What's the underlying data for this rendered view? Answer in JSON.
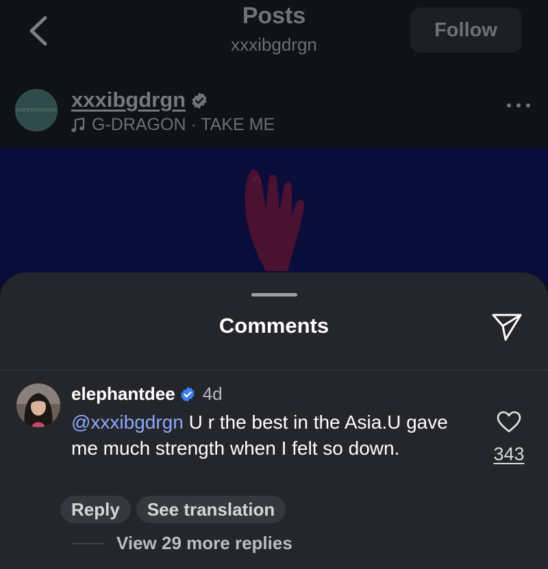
{
  "header": {
    "title": "Posts",
    "subtitle": "xxxibgdrgn",
    "follow_label": "Follow"
  },
  "post": {
    "username": "xxxibgdrgn",
    "verified": true,
    "music": "G-DRAGON · TAKE ME",
    "avatar_text": "Peaceminusone"
  },
  "comments_sheet": {
    "title": "Comments",
    "comment": {
      "username": "elephantdee",
      "verified": true,
      "time": "4d",
      "mention": "@xxxibgdrgn",
      "text": " U r the best in the Asia.U gave me much strength when I felt so down.",
      "like_count": "343",
      "reply_label": "Reply",
      "translate_label": "See translation",
      "view_replies": "View 29 more replies"
    }
  },
  "colors": {
    "sheet_bg": "#24262b",
    "mention": "#8ea8ff",
    "verified": "#3b82f6",
    "media_bg": "#0a0d3a"
  }
}
